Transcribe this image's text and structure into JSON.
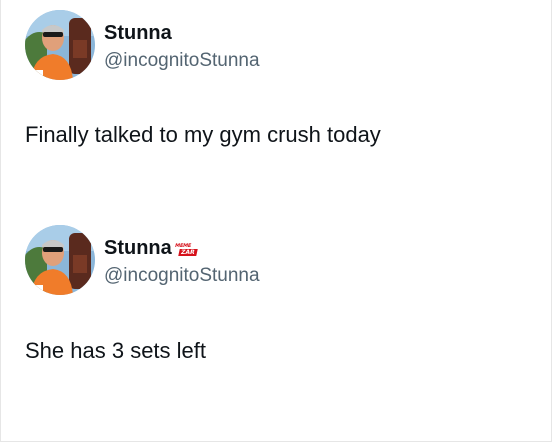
{
  "colors": {
    "name": "#0f1419",
    "handle": "#536471",
    "watermark": "#d6111b"
  },
  "tweets": [
    {
      "display_name": "Stunna",
      "handle": "@incognitoStunna",
      "text": "Finally talked to my gym crush today",
      "avatar_icon": "profile-photo"
    },
    {
      "display_name": "Stunna",
      "handle": "@incognitoStunna",
      "text": "She has 3 sets left",
      "avatar_icon": "profile-photo",
      "watermark": {
        "top": "MEME",
        "bottom": "ZAR"
      }
    }
  ]
}
